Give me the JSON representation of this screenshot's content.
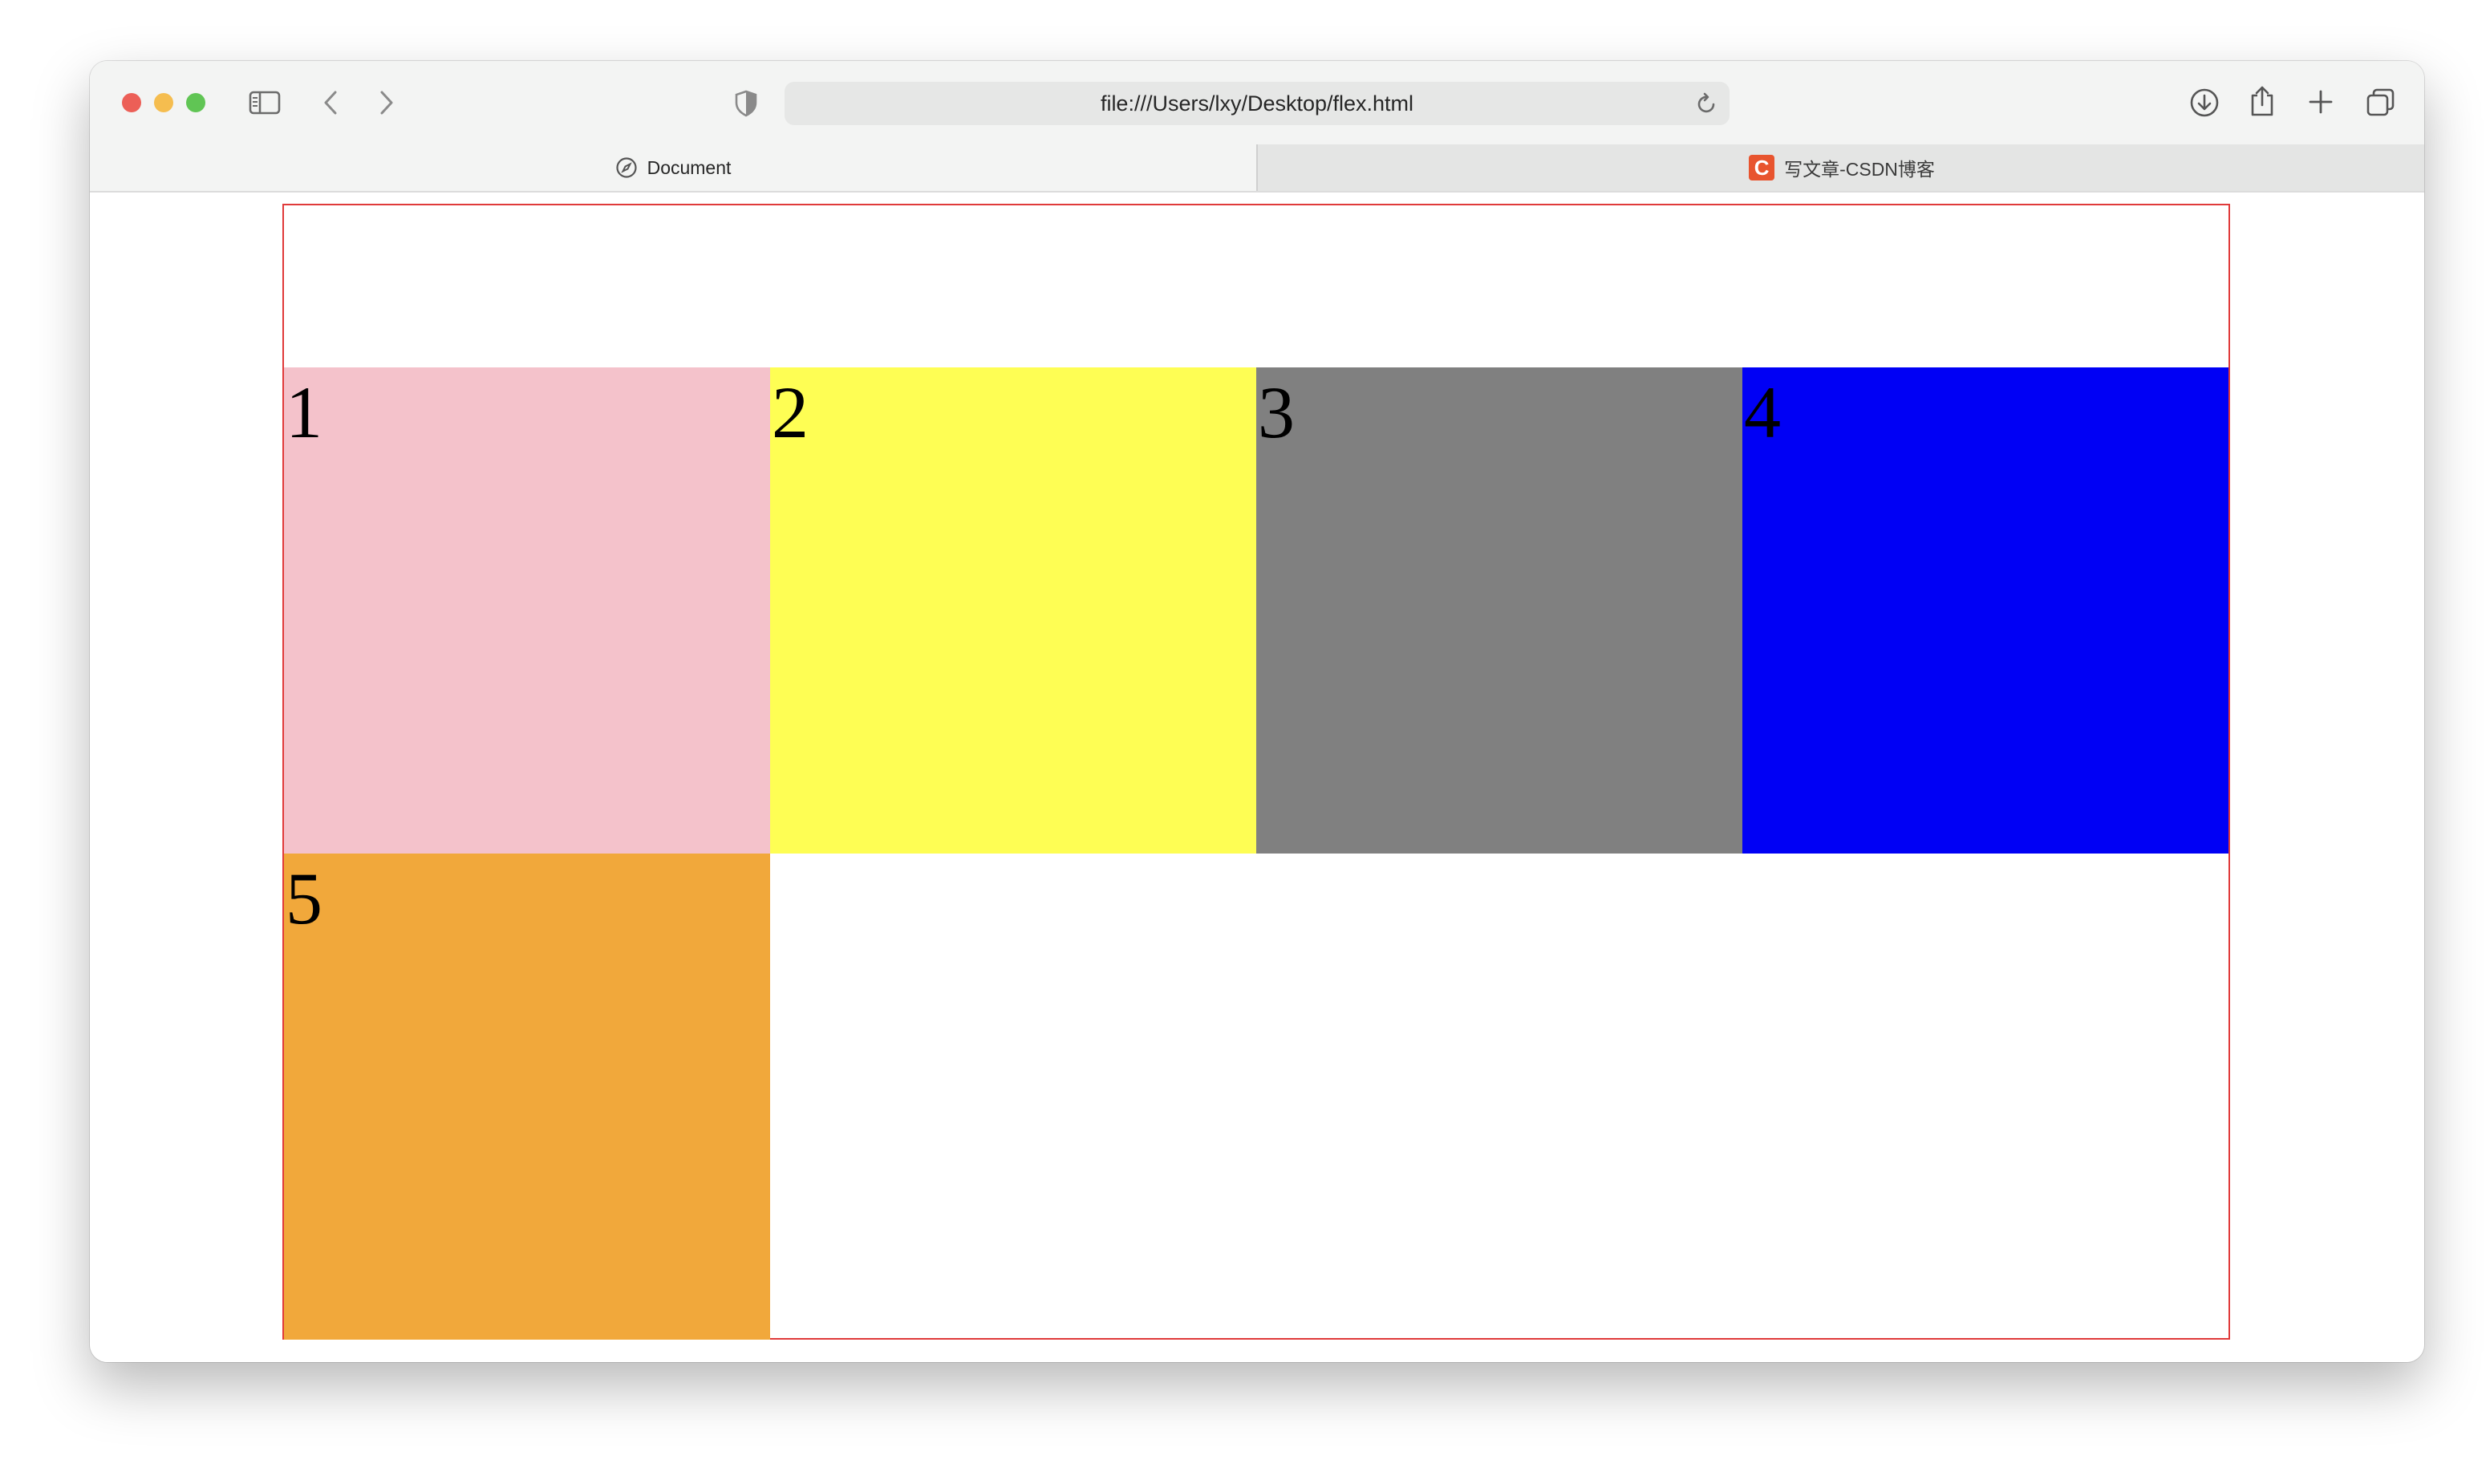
{
  "browser": {
    "url": "file:///Users/lxy/Desktop/flex.html",
    "tabs": [
      {
        "label": "Document",
        "icon": "compass-icon",
        "active": true
      },
      {
        "label": "写文章-CSDN博客",
        "icon": "csdn-logo-icon",
        "icon_text": "C",
        "active": false
      }
    ]
  },
  "page": {
    "container_border_color": "#e03a3a",
    "boxes": [
      {
        "label": "1",
        "color": "#f4c2cb"
      },
      {
        "label": "2",
        "color": "#fefe54"
      },
      {
        "label": "3",
        "color": "#808080"
      },
      {
        "label": "4",
        "color": "#0000f5"
      },
      {
        "label": "5",
        "color": "#f1a83b"
      }
    ]
  }
}
